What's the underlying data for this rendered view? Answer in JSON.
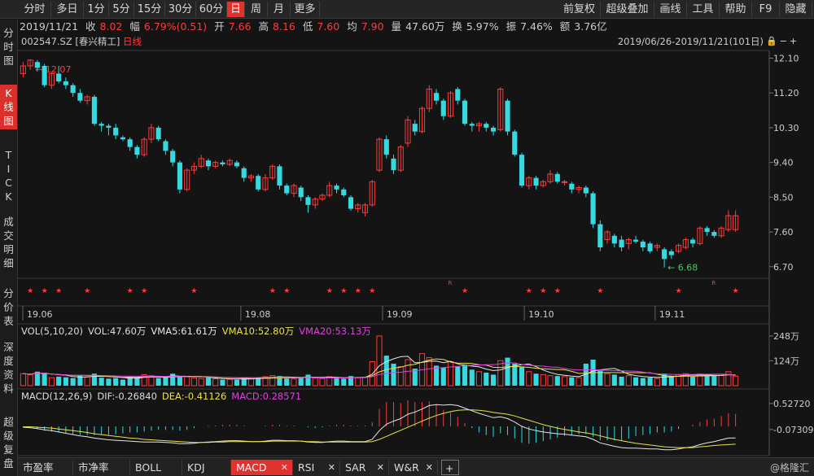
{
  "toolbar": {
    "left_tabs": [
      "分时",
      "多日",
      "1分",
      "5分",
      "15分",
      "30分",
      "60分",
      "日",
      "周",
      "月",
      "更多"
    ],
    "active_tab": "日",
    "right_tabs": [
      "前复权",
      "超级叠加",
      "画线",
      "工具",
      "帮助",
      "F9",
      "隐藏"
    ]
  },
  "info": {
    "date": "2019/11/21",
    "close_label": "收",
    "close": "8.02",
    "change_label": "幅",
    "change": "6.79%(0.51)",
    "open_label": "开",
    "open": "7.66",
    "high_label": "高",
    "high": "8.16",
    "low_label": "低",
    "low": "7.60",
    "avg_label": "均",
    "avg": "7.90",
    "vol_label": "量",
    "vol": "47.60万",
    "turnover_label": "换",
    "turnover": "5.97%",
    "amplitude_label": "振",
    "amplitude": "7.46%",
    "amount_label": "额",
    "amount": "3.76亿"
  },
  "side_tabs": [
    "分时图",
    "K线图",
    "TICK",
    "成交明细",
    "分价表",
    "深度资料",
    "超级复盘"
  ],
  "active_side_tab": "K线图",
  "chart_header": {
    "code": "002547.SZ [春兴精工]",
    "period": "日线",
    "range": "2019/06/26-2019/11/21(101日)"
  },
  "price_axis": [
    "12.10",
    "11.20",
    "10.30",
    "9.40",
    "8.50",
    "7.60",
    "6.70"
  ],
  "date_axis": [
    "19.06",
    "19.08",
    "19.09",
    "19.10",
    "19.11"
  ],
  "annotations": {
    "high": "12.07",
    "low": "6.68",
    "r_marker": "R"
  },
  "vol_header": {
    "title": "VOL(5,10,20)",
    "vol": "VOL:47.60万",
    "vma5": "VMA5:61.61万",
    "vma10": "VMA10:52.80万",
    "vma20": "VMA20:53.13万"
  },
  "vol_axis": [
    "248万",
    "124万"
  ],
  "macd_header": {
    "title": "MACD(12,26,9)",
    "dif": "DIF:-0.26840",
    "dea": "DEA:-0.41126",
    "macd": "MACD:0.28571"
  },
  "macd_axis": [
    "0.52720",
    "-0.07309"
  ],
  "bottom_tabs": [
    "市盈率",
    "市净率",
    "BOLL",
    "KDJ",
    "MACD",
    "RSI",
    "SAR",
    "W&R"
  ],
  "active_bottom_tab": "MACD",
  "watermark": "@格隆汇",
  "colors": {
    "up": "#ff3b3b",
    "down": "#35d9e0",
    "vma5": "#e6e6e6",
    "vma10": "#e8e24a",
    "vma20": "#e040e0",
    "accent": "#e0332e"
  },
  "chart_data": {
    "type": "candlestick",
    "title": "002547.SZ 日线",
    "y_range": [
      6.4,
      12.3
    ],
    "candles": [
      [
        11.7,
        11.9,
        11.6,
        12.0
      ],
      [
        11.9,
        12.05,
        11.8,
        12.07
      ],
      [
        12.0,
        11.85,
        11.75,
        12.05
      ],
      [
        11.9,
        11.4,
        11.35,
        11.95
      ],
      [
        11.4,
        11.7,
        11.3,
        11.75
      ],
      [
        11.7,
        11.5,
        11.45,
        11.9
      ],
      [
        11.5,
        11.4,
        11.3,
        11.6
      ],
      [
        11.4,
        11.2,
        11.1,
        11.45
      ],
      [
        11.2,
        11.0,
        10.95,
        11.3
      ],
      [
        11.0,
        11.1,
        10.9,
        11.15
      ],
      [
        11.1,
        10.4,
        10.35,
        11.15
      ],
      [
        10.4,
        10.35,
        10.2,
        10.45
      ],
      [
        10.35,
        10.3,
        10.1,
        10.4
      ],
      [
        10.3,
        10.1,
        10.0,
        10.4
      ],
      [
        10.05,
        10.0,
        9.95,
        10.1
      ],
      [
        10.0,
        9.8,
        9.7,
        10.05
      ],
      [
        9.8,
        9.6,
        9.5,
        9.85
      ],
      [
        9.6,
        10.0,
        9.55,
        10.05
      ],
      [
        10.0,
        10.3,
        9.9,
        10.4
      ],
      [
        10.3,
        10.0,
        9.95,
        10.35
      ],
      [
        9.95,
        9.7,
        9.6,
        10.0
      ],
      [
        9.7,
        9.4,
        9.3,
        9.75
      ],
      [
        9.4,
        8.7,
        8.6,
        9.45
      ],
      [
        8.7,
        9.2,
        8.65,
        9.25
      ],
      [
        9.2,
        9.3,
        9.1,
        9.4
      ],
      [
        9.3,
        9.5,
        9.25,
        9.6
      ],
      [
        9.45,
        9.3,
        9.2,
        9.5
      ],
      [
        9.3,
        9.4,
        9.25,
        9.45
      ],
      [
        9.4,
        9.35,
        9.3,
        9.45
      ],
      [
        9.35,
        9.45,
        9.3,
        9.5
      ],
      [
        9.4,
        9.3,
        9.25,
        9.45
      ],
      [
        9.25,
        9.0,
        8.9,
        9.3
      ],
      [
        9.0,
        9.05,
        8.9,
        9.1
      ],
      [
        9.05,
        8.7,
        8.65,
        9.1
      ],
      [
        8.7,
        9.0,
        8.65,
        9.1
      ],
      [
        9.0,
        9.3,
        8.95,
        9.35
      ],
      [
        9.3,
        8.8,
        8.7,
        9.35
      ],
      [
        8.8,
        8.6,
        8.55,
        8.85
      ],
      [
        8.6,
        8.8,
        8.5,
        8.85
      ],
      [
        8.75,
        8.5,
        8.4,
        8.8
      ],
      [
        8.5,
        8.3,
        8.1,
        8.55
      ],
      [
        8.3,
        8.45,
        8.2,
        8.5
      ],
      [
        8.45,
        8.55,
        8.4,
        8.6
      ],
      [
        8.55,
        8.8,
        8.5,
        8.9
      ],
      [
        8.8,
        8.7,
        8.6,
        8.85
      ],
      [
        8.7,
        8.55,
        8.5,
        8.75
      ],
      [
        8.5,
        8.2,
        8.15,
        8.55
      ],
      [
        8.2,
        8.3,
        8.1,
        8.35
      ],
      [
        8.1,
        8.3,
        8.0,
        8.35
      ],
      [
        8.3,
        8.9,
        8.25,
        8.95
      ],
      [
        9.2,
        10.0,
        9.15,
        10.05
      ],
      [
        10.0,
        9.6,
        9.5,
        10.1
      ],
      [
        9.5,
        9.2,
        9.1,
        9.6
      ],
      [
        9.2,
        9.8,
        9.15,
        9.85
      ],
      [
        9.9,
        10.5,
        9.8,
        10.6
      ],
      [
        10.4,
        10.2,
        10.1,
        10.5
      ],
      [
        10.2,
        10.8,
        10.15,
        10.85
      ],
      [
        10.8,
        11.3,
        10.7,
        11.4
      ],
      [
        11.2,
        11.0,
        10.9,
        11.3
      ],
      [
        11.0,
        10.6,
        10.5,
        11.05
      ],
      [
        10.6,
        11.2,
        10.55,
        11.25
      ],
      [
        11.3,
        11.0,
        10.9,
        11.35
      ],
      [
        11.0,
        10.4,
        10.35,
        11.05
      ],
      [
        10.4,
        10.35,
        10.2,
        10.45
      ],
      [
        10.35,
        10.4,
        10.2,
        10.45
      ],
      [
        10.4,
        10.3,
        10.2,
        10.45
      ],
      [
        10.3,
        10.2,
        10.1,
        10.35
      ],
      [
        10.25,
        11.3,
        10.2,
        11.35
      ],
      [
        11.0,
        10.2,
        10.1,
        11.05
      ],
      [
        10.2,
        9.6,
        9.55,
        10.25
      ],
      [
        9.6,
        8.8,
        8.75,
        9.65
      ],
      [
        8.8,
        9.0,
        8.7,
        9.05
      ],
      [
        9.0,
        8.8,
        8.7,
        9.05
      ],
      [
        8.8,
        8.9,
        8.75,
        8.95
      ],
      [
        8.9,
        9.1,
        8.85,
        9.2
      ],
      [
        9.1,
        8.9,
        8.85,
        9.15
      ],
      [
        8.9,
        8.9,
        8.8,
        8.95
      ],
      [
        8.85,
        8.7,
        8.6,
        8.9
      ],
      [
        8.7,
        8.75,
        8.6,
        8.8
      ],
      [
        8.75,
        8.6,
        8.5,
        8.8
      ],
      [
        8.6,
        7.8,
        7.7,
        8.65
      ],
      [
        7.8,
        7.2,
        7.1,
        7.9
      ],
      [
        7.4,
        7.6,
        7.3,
        7.65
      ],
      [
        7.5,
        7.3,
        7.2,
        7.55
      ],
      [
        7.4,
        7.2,
        7.1,
        7.5
      ],
      [
        7.3,
        7.4,
        7.15,
        7.45
      ],
      [
        7.4,
        7.35,
        7.3,
        7.5
      ],
      [
        7.35,
        7.2,
        7.1,
        7.4
      ],
      [
        7.3,
        7.1,
        7.05,
        7.35
      ],
      [
        7.2,
        7.25,
        7.1,
        7.3
      ],
      [
        7.15,
        6.9,
        6.68,
        7.2
      ],
      [
        7.1,
        7.0,
        6.9,
        7.15
      ],
      [
        7.1,
        7.25,
        7.05,
        7.3
      ],
      [
        7.2,
        7.4,
        7.15,
        7.45
      ],
      [
        7.4,
        7.3,
        7.2,
        7.45
      ],
      [
        7.3,
        7.7,
        7.25,
        7.75
      ],
      [
        7.7,
        7.6,
        7.5,
        7.75
      ],
      [
        7.6,
        7.5,
        7.45,
        7.65
      ],
      [
        7.5,
        7.7,
        7.45,
        7.75
      ],
      [
        7.66,
        8.02,
        7.6,
        8.16
      ],
      [
        7.66,
        8.02,
        7.6,
        8.16
      ]
    ],
    "volume_wan": [
      60,
      55,
      70,
      65,
      40,
      45,
      42,
      38,
      50,
      45,
      60,
      40,
      35,
      38,
      30,
      45,
      40,
      55,
      50,
      38,
      42,
      60,
      48,
      45,
      38,
      36,
      40,
      34,
      30,
      32,
      30,
      42,
      35,
      40,
      45,
      50,
      48,
      36,
      34,
      40,
      55,
      38,
      35,
      45,
      38,
      35,
      48,
      40,
      42,
      120,
      248,
      150,
      110,
      95,
      130,
      85,
      160,
      140,
      100,
      90,
      120,
      95,
      105,
      80,
      70,
      65,
      55,
      125,
      140,
      110,
      95,
      70,
      60,
      55,
      50,
      48,
      45,
      42,
      40,
      110,
      130,
      75,
      60,
      55,
      45,
      50,
      42,
      38,
      40,
      36,
      60,
      48,
      55,
      60,
      45,
      58,
      50,
      48,
      52,
      70,
      47.6
    ],
    "vma5": [],
    "vma10": [],
    "vma20": [],
    "macd": {
      "dif": [
        -0.02,
        -0.03,
        -0.05,
        -0.08,
        -0.1,
        -0.13,
        -0.16,
        -0.19,
        -0.22,
        -0.24,
        -0.27,
        -0.29,
        -0.31,
        -0.32,
        -0.33,
        -0.34,
        -0.35,
        -0.36,
        -0.36,
        -0.36,
        -0.37,
        -0.38,
        -0.4,
        -0.4,
        -0.39,
        -0.37,
        -0.36,
        -0.35,
        -0.34,
        -0.33,
        -0.33,
        -0.34,
        -0.35,
        -0.35,
        -0.34,
        -0.32,
        -0.32,
        -0.33,
        -0.33,
        -0.34,
        -0.36,
        -0.37,
        -0.37,
        -0.35,
        -0.34,
        -0.34,
        -0.35,
        -0.35,
        -0.35,
        -0.3,
        -0.1,
        0.05,
        0.12,
        0.18,
        0.28,
        0.33,
        0.4,
        0.48,
        0.5,
        0.49,
        0.5,
        0.48,
        0.42,
        0.36,
        0.3,
        0.25,
        0.2,
        0.22,
        0.18,
        0.1,
        0.0,
        -0.06,
        -0.1,
        -0.13,
        -0.15,
        -0.17,
        -0.18,
        -0.2,
        -0.22,
        -0.24,
        -0.3,
        -0.38,
        -0.42,
        -0.46,
        -0.49,
        -0.5,
        -0.5,
        -0.51,
        -0.52,
        -0.52,
        -0.54,
        -0.54,
        -0.52,
        -0.49,
        -0.47,
        -0.42,
        -0.38,
        -0.35,
        -0.31,
        -0.27,
        -0.268
      ],
      "dea": [
        -0.01,
        -0.01,
        -0.02,
        -0.03,
        -0.04,
        -0.06,
        -0.08,
        -0.1,
        -0.12,
        -0.14,
        -0.17,
        -0.19,
        -0.21,
        -0.23,
        -0.25,
        -0.27,
        -0.28,
        -0.3,
        -0.31,
        -0.32,
        -0.33,
        -0.34,
        -0.35,
        -0.36,
        -0.37,
        -0.37,
        -0.37,
        -0.36,
        -0.36,
        -0.35,
        -0.35,
        -0.35,
        -0.35,
        -0.35,
        -0.35,
        -0.34,
        -0.34,
        -0.34,
        -0.34,
        -0.34,
        -0.35,
        -0.35,
        -0.36,
        -0.36,
        -0.36,
        -0.36,
        -0.36,
        -0.36,
        -0.36,
        -0.35,
        -0.3,
        -0.23,
        -0.16,
        -0.09,
        -0.02,
        0.05,
        0.12,
        0.19,
        0.25,
        0.3,
        0.34,
        0.37,
        0.38,
        0.38,
        0.37,
        0.35,
        0.32,
        0.3,
        0.28,
        0.24,
        0.19,
        0.14,
        0.09,
        0.04,
        0.0,
        -0.04,
        -0.07,
        -0.1,
        -0.13,
        -0.15,
        -0.18,
        -0.22,
        -0.26,
        -0.3,
        -0.33,
        -0.36,
        -0.39,
        -0.41,
        -0.43,
        -0.45,
        -0.47,
        -0.48,
        -0.49,
        -0.49,
        -0.49,
        -0.47,
        -0.46,
        -0.44,
        -0.43,
        -0.42,
        -0.411
      ]
    }
  }
}
